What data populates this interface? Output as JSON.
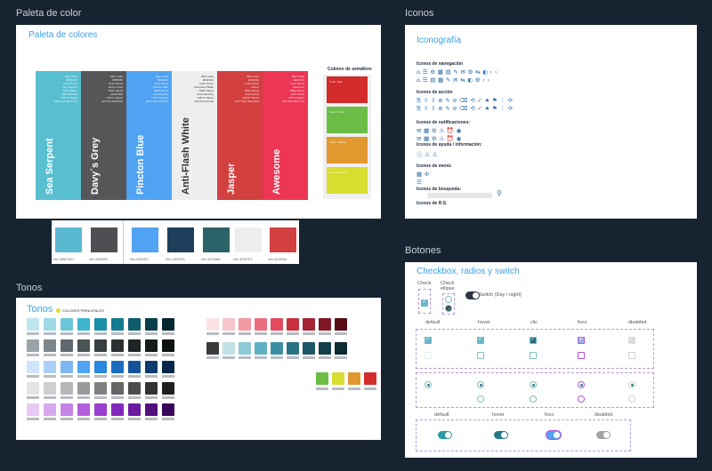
{
  "frames": {
    "palette": "Paleta de color",
    "icons": "Iconos",
    "tones": "Tonos",
    "buttons": "Botones"
  },
  "palette_card": {
    "title": "Paleta de colores",
    "colors": [
      {
        "name": "Sea Serpent",
        "hex": "#4BC3C5",
        "color": "#58bfd0",
        "meta": [
          "HEX Code",
          "#58BCD3",
          "Color Name",
          "Sea Serpent",
          "RGB Values",
          "(88,188,211)",
          "CMYK Values",
          "(58%,11%,0%,17%)"
        ]
      },
      {
        "name": "Davy´s Grey",
        "hex": "#555555",
        "color": "#555658",
        "meta": [
          "HEX Code",
          "#555658",
          "Color Name",
          "Davy's Grey",
          "RGB Values",
          "(85,86,88)",
          "CMYK Values",
          "(3%,2%,0%,65%)"
        ]
      },
      {
        "name": "Pincton Blue",
        "hex": "#4FA3F2",
        "color": "#4fa3f2",
        "meta": [
          "HEX Code",
          "#4FA3F2",
          "Color Name",
          "Pincton Blue",
          "RGB Values",
          "(79,163,242)",
          "CMYK Values",
          "(67%,33%,0%,5%)"
        ]
      },
      {
        "name": "Anti-Flash White",
        "hex": "#F2F2F2",
        "color": "#eeeeee",
        "meta": [
          "HEX Code",
          "#F2F2F2",
          "Color Name",
          "Anti-Flash White",
          "RGB Values",
          "(242,242,242)",
          "CMYK Values",
          "(0%,0%,0%,5%)"
        ]
      },
      {
        "name": "Jasper",
        "hex": "#D24040",
        "color": "#d24040",
        "meta": [
          "HEX Code",
          "#D24040",
          "Color Name",
          "Jasper",
          "RGB Values",
          "(210,64,64)",
          "CMYK Values",
          "(0%,70%,70%,18%)"
        ]
      },
      {
        "name": "Awesome",
        "hex": "#ED3554",
        "color": "#ed3554",
        "meta": [
          "HEX Code",
          "#ED3554",
          "Color Name",
          "Awesome",
          "RGB Values",
          "(237,53,84)",
          "CMYK Values",
          "(0%,78%,65%,7%)"
        ]
      }
    ],
    "semaphore_title": "Colores de semáforo",
    "semaphore": [
      {
        "label": "Color: Rojo",
        "color": "#d42b2b"
      },
      {
        "label": "Color: Verde",
        "color": "#6bbd45"
      },
      {
        "label": "Color: Naranja",
        "color": "#e0982f"
      },
      {
        "label": "Color: Amarillo",
        "color": "#d7de2f"
      }
    ],
    "swatches": [
      {
        "color": "#5bb8d1",
        "label": "Hex #5BC3CD"
      },
      {
        "color": "#4d4f52",
        "label": "Hex #555555"
      },
      {
        "color": "#4fa3f2",
        "label": "Hex #4FA3F2"
      },
      {
        "color": "#1e3f5c",
        "label": "Hex #1E3F5C"
      },
      {
        "color": "#2c6368",
        "label": "Hex #2C6368"
      },
      {
        "color": "#eeeeee",
        "label": "Hex #F3F3F3"
      },
      {
        "color": "#d24040",
        "label": "Hex #D24040"
      }
    ]
  },
  "tones_card": {
    "title": "Tonos",
    "legend": "COLORES PRINCIPALES",
    "left_colors": [
      [
        "#bfe7ee",
        "#9dd9e6",
        "#6cc6d9",
        "#3fb3cb",
        "#1b8fa8",
        "#137a91",
        "#0e5c6e",
        "#0a3f4c",
        "#062830"
      ],
      [
        "#9aa3a8",
        "#7c8589",
        "#5f686c",
        "#4b5357",
        "#383f42",
        "#2a3032",
        "#1f2426",
        "#151a1b",
        "#0e1213"
      ],
      [
        "#cfe4fb",
        "#a9cff7",
        "#7fb7f3",
        "#4fa3f2",
        "#2a86de",
        "#1c6cc0",
        "#14539a",
        "#0d3b70",
        "#082748"
      ],
      [
        "#e4e4e4",
        "#cfcfcf",
        "#b7b7b7",
        "#9a9a9a",
        "#808080",
        "#656565",
        "#4c4c4c",
        "#333333",
        "#1f1f1f"
      ],
      [
        "#e8c9f3",
        "#d8a8ee",
        "#c683e6",
        "#b25fdd",
        "#9a3fcf",
        "#8228bd",
        "#6b1aa0",
        "#520f7e",
        "#3a065a"
      ]
    ],
    "right_colors": [
      [
        "#fbe3e5",
        "#f7c6cb",
        "#f29aa3",
        "#ec6d7c",
        "#e44a5d",
        "#c9303f",
        "#a52233",
        "#7e1826",
        "#560d18"
      ],
      [
        "#3b3b3b",
        "#bfe1e6",
        "#8bcad6",
        "#5fb0c2",
        "#3b8ea2",
        "#2a7185",
        "#1e5567",
        "#153e4b",
        "#0e2a33"
      ]
    ],
    "semaphore_tones": [
      "#6bbd45",
      "#d7de2f",
      "#e0982f",
      "#d42b2b"
    ]
  },
  "icons_card": {
    "title": "Iconografía",
    "groups": [
      {
        "label": "Iconos de navegación",
        "rows": [
          "⌂ ☰ ⚙ ▦ ▤ ✎ ✉ ⚙ ⇆ ◐ ‹ ›",
          "⌂ ☰ ▤ ▦ ✎ ✉ ⇆ ◐ ⚙ ‹ ›"
        ]
      },
      {
        "label": "Iconos de acción",
        "rows": [
          "⎘ ⇩ ⇧ ⊕ ✎ ⊘ ⌫ ⟲ ✓ ★ ⚑ ⋮ ⟳",
          "⎘ ⇩ ⇧ ⊕ ✎ ⊘ ⌫ ⟲ ✓ ★ ⚑ ⋮ ⟳"
        ]
      },
      {
        "label": "Iconos de notificaciones:",
        "rows": [
          "✉ ▦ ⚙ ⚠ ⏰ ◉",
          "✉ ▦ ⚙ ⚠ ⏰ ◉"
        ]
      },
      {
        "label": "Iconos de ayuda / información:",
        "rows": [
          "ⓘ ⚠ ⚠"
        ]
      },
      {
        "label": "Iconos de menú:",
        "rows": [
          "▦ ✣",
          "☰"
        ]
      },
      {
        "label": "Iconos de búsqueda:",
        "rows": []
      },
      {
        "label": "Iconos de R.S.",
        "rows": []
      }
    ]
  },
  "buttons_card": {
    "title": "Checkbox, radios y switch",
    "check_label": "Check",
    "check_ellipse_label": "Check ellipse",
    "switch_label": "Switch (Day / night)",
    "states": [
      "default",
      "hover",
      "clic",
      "foco",
      "disabled"
    ],
    "switch_states": [
      "default",
      "hover",
      "foco",
      "disabled"
    ]
  }
}
